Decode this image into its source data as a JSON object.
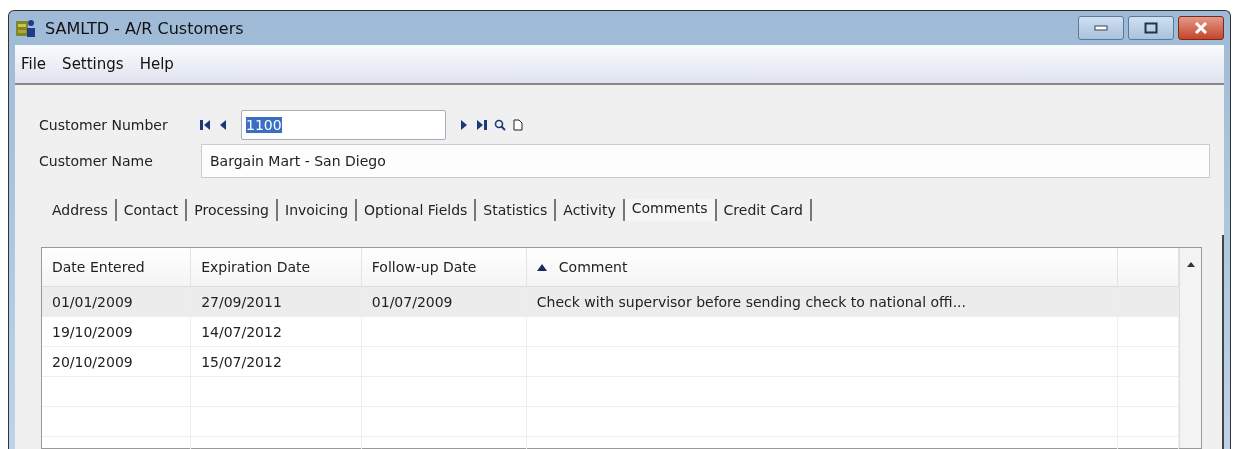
{
  "window": {
    "title": "SAMLTD - A/R Customers"
  },
  "menu": [
    "File",
    "Settings",
    "Help"
  ],
  "customer_number": {
    "label": "Customer Number",
    "value": "1100"
  },
  "customer_name": {
    "label": "Customer Name",
    "value": "Bargain Mart - San Diego"
  },
  "tabs": [
    {
      "label": "Address",
      "selected": false
    },
    {
      "label": "Contact",
      "selected": false
    },
    {
      "label": "Processing",
      "selected": false
    },
    {
      "label": "Invoicing",
      "selected": false
    },
    {
      "label": "Optional Fields",
      "selected": false
    },
    {
      "label": "Statistics",
      "selected": false
    },
    {
      "label": "Activity",
      "selected": false
    },
    {
      "label": "Comments",
      "selected": true
    },
    {
      "label": "Credit Card",
      "selected": false
    }
  ],
  "table": {
    "columns": [
      {
        "label": "Date Entered",
        "sorted": false
      },
      {
        "label": "Expiration Date",
        "sorted": false
      },
      {
        "label": "Follow-up Date",
        "sorted": false
      },
      {
        "label": "Comment",
        "sorted": true
      }
    ],
    "rows": [
      {
        "cells": [
          "01/01/2009",
          "27/09/2011",
          "01/07/2009",
          "Check with supervisor before sending check to national offi..."
        ],
        "selected": true
      },
      {
        "cells": [
          "19/10/2009",
          "14/07/2012",
          "",
          ""
        ],
        "selected": false
      },
      {
        "cells": [
          "20/10/2009",
          "15/07/2012",
          "",
          ""
        ],
        "selected": false
      }
    ]
  }
}
